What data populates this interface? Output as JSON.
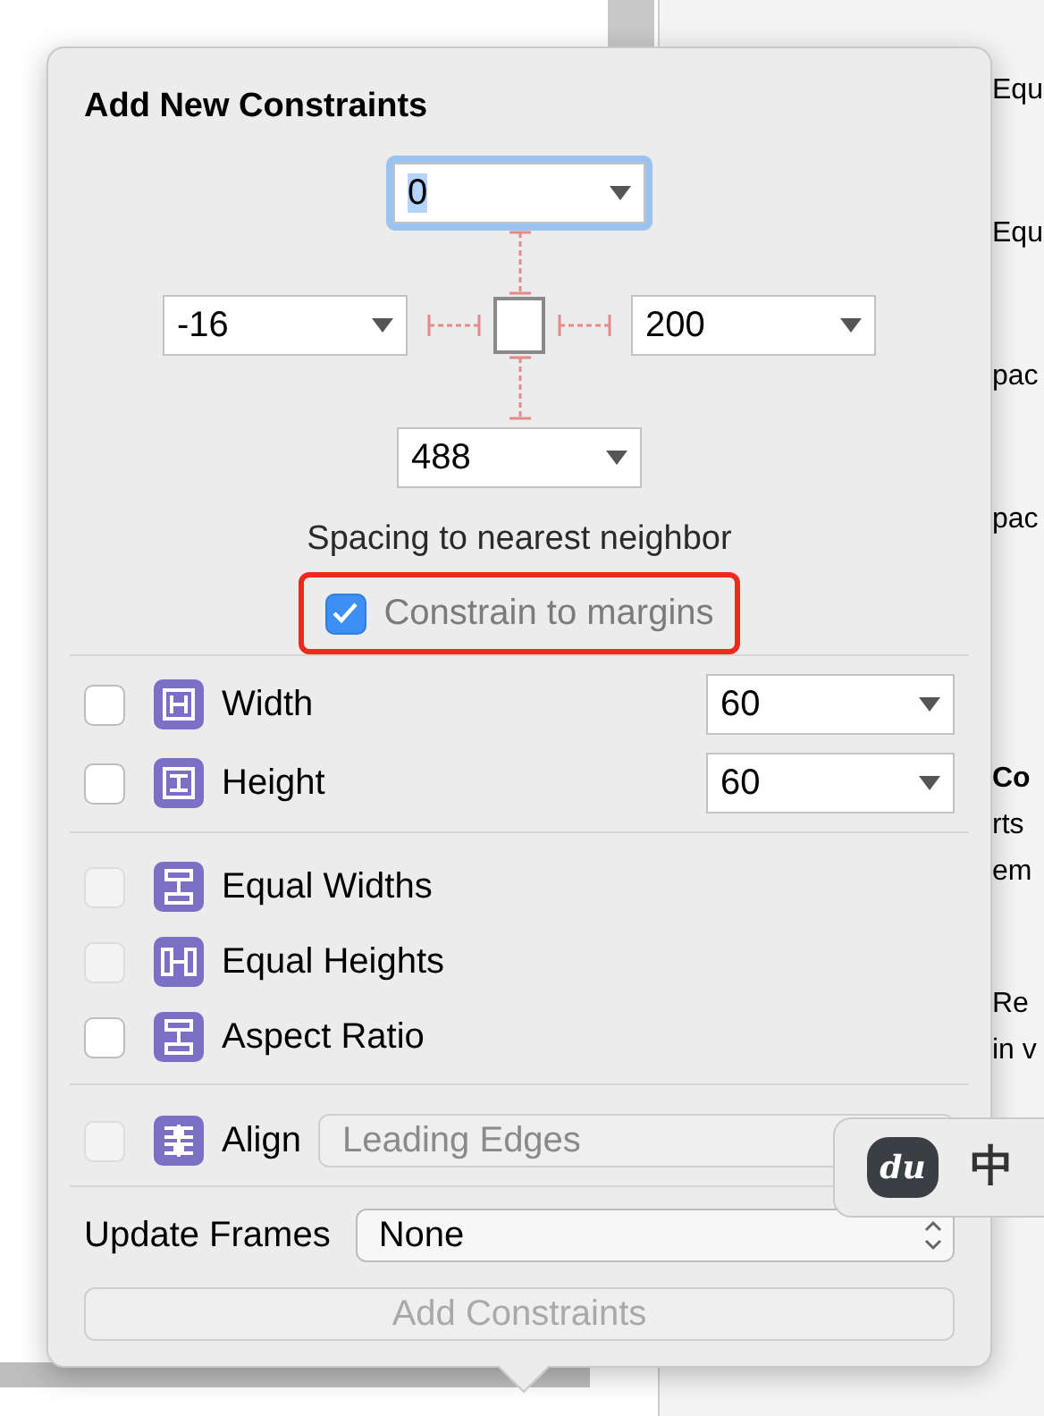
{
  "background_panel": {
    "texts": [
      {
        "kind": "plain",
        "text": "Equ"
      },
      {
        "kind": "plain",
        "text": "Equ"
      },
      {
        "kind": "plain",
        "text": "pac"
      },
      {
        "kind": "plain",
        "text": "pac"
      },
      {
        "kind": "bold",
        "text": "Co"
      },
      {
        "kind": "plain",
        "text": "rts"
      },
      {
        "kind": "plain",
        "text": "em"
      },
      {
        "kind": "plain",
        "text": "Re"
      },
      {
        "kind": "plain",
        "text": "in v"
      }
    ]
  },
  "popover": {
    "title": "Add New Constraints",
    "spacing": {
      "top": {
        "value": "0",
        "focused": true
      },
      "left": {
        "value": "-16",
        "focused": false
      },
      "right": {
        "value": "200",
        "focused": false
      },
      "bottom": {
        "value": "488",
        "focused": false
      }
    },
    "spacing_caption": "Spacing to nearest neighbor",
    "constrain_to_margins": {
      "label": "Constrain to margins",
      "checked": true,
      "highlighted": true
    },
    "size_rows": [
      {
        "kind": "width",
        "label": "Width",
        "checked": false,
        "value": "60"
      },
      {
        "kind": "height",
        "label": "Height",
        "checked": false,
        "value": "60"
      }
    ],
    "equal_rows": [
      {
        "kind": "equal-widths",
        "label": "Equal Widths",
        "checked": false,
        "disabled": true
      },
      {
        "kind": "equal-heights",
        "label": "Equal Heights",
        "checked": false,
        "disabled": true
      },
      {
        "kind": "aspect-ratio",
        "label": "Aspect Ratio",
        "checked": false,
        "disabled": false
      }
    ],
    "align": {
      "label": "Align",
      "checked": false,
      "disabled": true,
      "value": "Leading Edges"
    },
    "update_frames": {
      "label": "Update Frames",
      "value": "None"
    },
    "add_button": {
      "label": "Add Constraints",
      "disabled": true
    }
  },
  "ime_bar": {
    "logo": "du",
    "label": "中"
  }
}
